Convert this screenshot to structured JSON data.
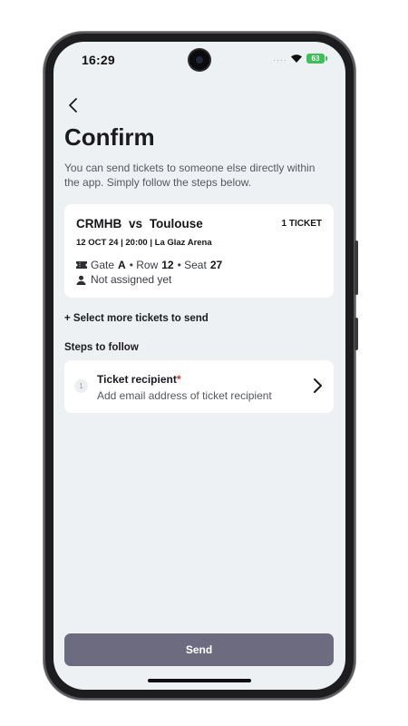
{
  "status": {
    "time": "16:29",
    "battery": "63"
  },
  "page": {
    "title": "Confirm",
    "subtitle": "You can send tickets to someone else directly within the app. Simply follow the steps below."
  },
  "ticket": {
    "team_home": "CRMHB",
    "vs": "vs",
    "team_away": "Toulouse",
    "count": "1 TICKET",
    "datetime": "12 OCT 24 | 20:00 | La Glaz Arena",
    "gate_label": "Gate",
    "gate": "A",
    "row_label": "• Row",
    "row": "12",
    "seat_label": "• Seat",
    "seat": "27",
    "assignment": "Not assigned yet"
  },
  "actions": {
    "select_more": "+ Select more tickets to send",
    "send": "Send"
  },
  "steps": {
    "heading": "Steps to follow",
    "items": [
      {
        "number": "1",
        "title": "Ticket recipient",
        "required_mark": "*",
        "subtitle": "Add email address of ticket recipient"
      }
    ]
  },
  "colors": {
    "background": "#eef1f4",
    "send_button": "#6d6b80",
    "required": "#d8322c",
    "battery": "#3fbf5a"
  }
}
